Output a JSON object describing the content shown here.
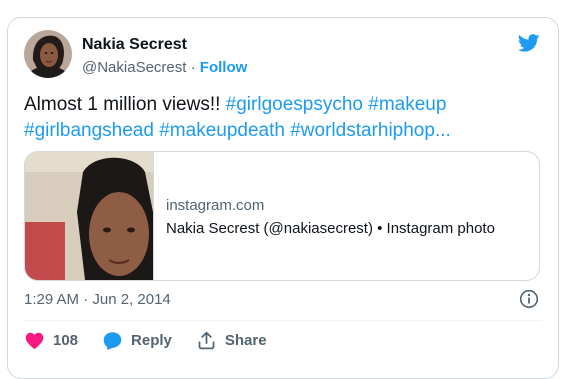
{
  "author": {
    "name": "Nakia Secrest",
    "handle": "@NakiaSecrest",
    "separator": "·",
    "follow_label": "Follow"
  },
  "tweet": {
    "text_plain": "Almost 1 million views!! ",
    "hashtags": [
      "#girlgoespsycho",
      "#makeup",
      "#girlbangshead",
      "#makeupdeath",
      "#worldstarhiphop",
      "..."
    ]
  },
  "link_card": {
    "domain": "instagram.com",
    "title": "Nakia Secrest (@nakiasecrest) • Instagram photo"
  },
  "meta": {
    "timestamp": "1:29 AM · Jun 2, 2014"
  },
  "actions": {
    "likes_count": "108",
    "reply_label": "Reply",
    "share_label": "Share"
  },
  "colors": {
    "accent": "#1d9bf0",
    "like": "#f91880",
    "text": "#0f1419",
    "muted": "#536471",
    "border": "#cfd9de"
  },
  "icons": [
    "twitter-bird-icon",
    "info-icon",
    "heart-icon",
    "reply-icon",
    "share-icon"
  ]
}
